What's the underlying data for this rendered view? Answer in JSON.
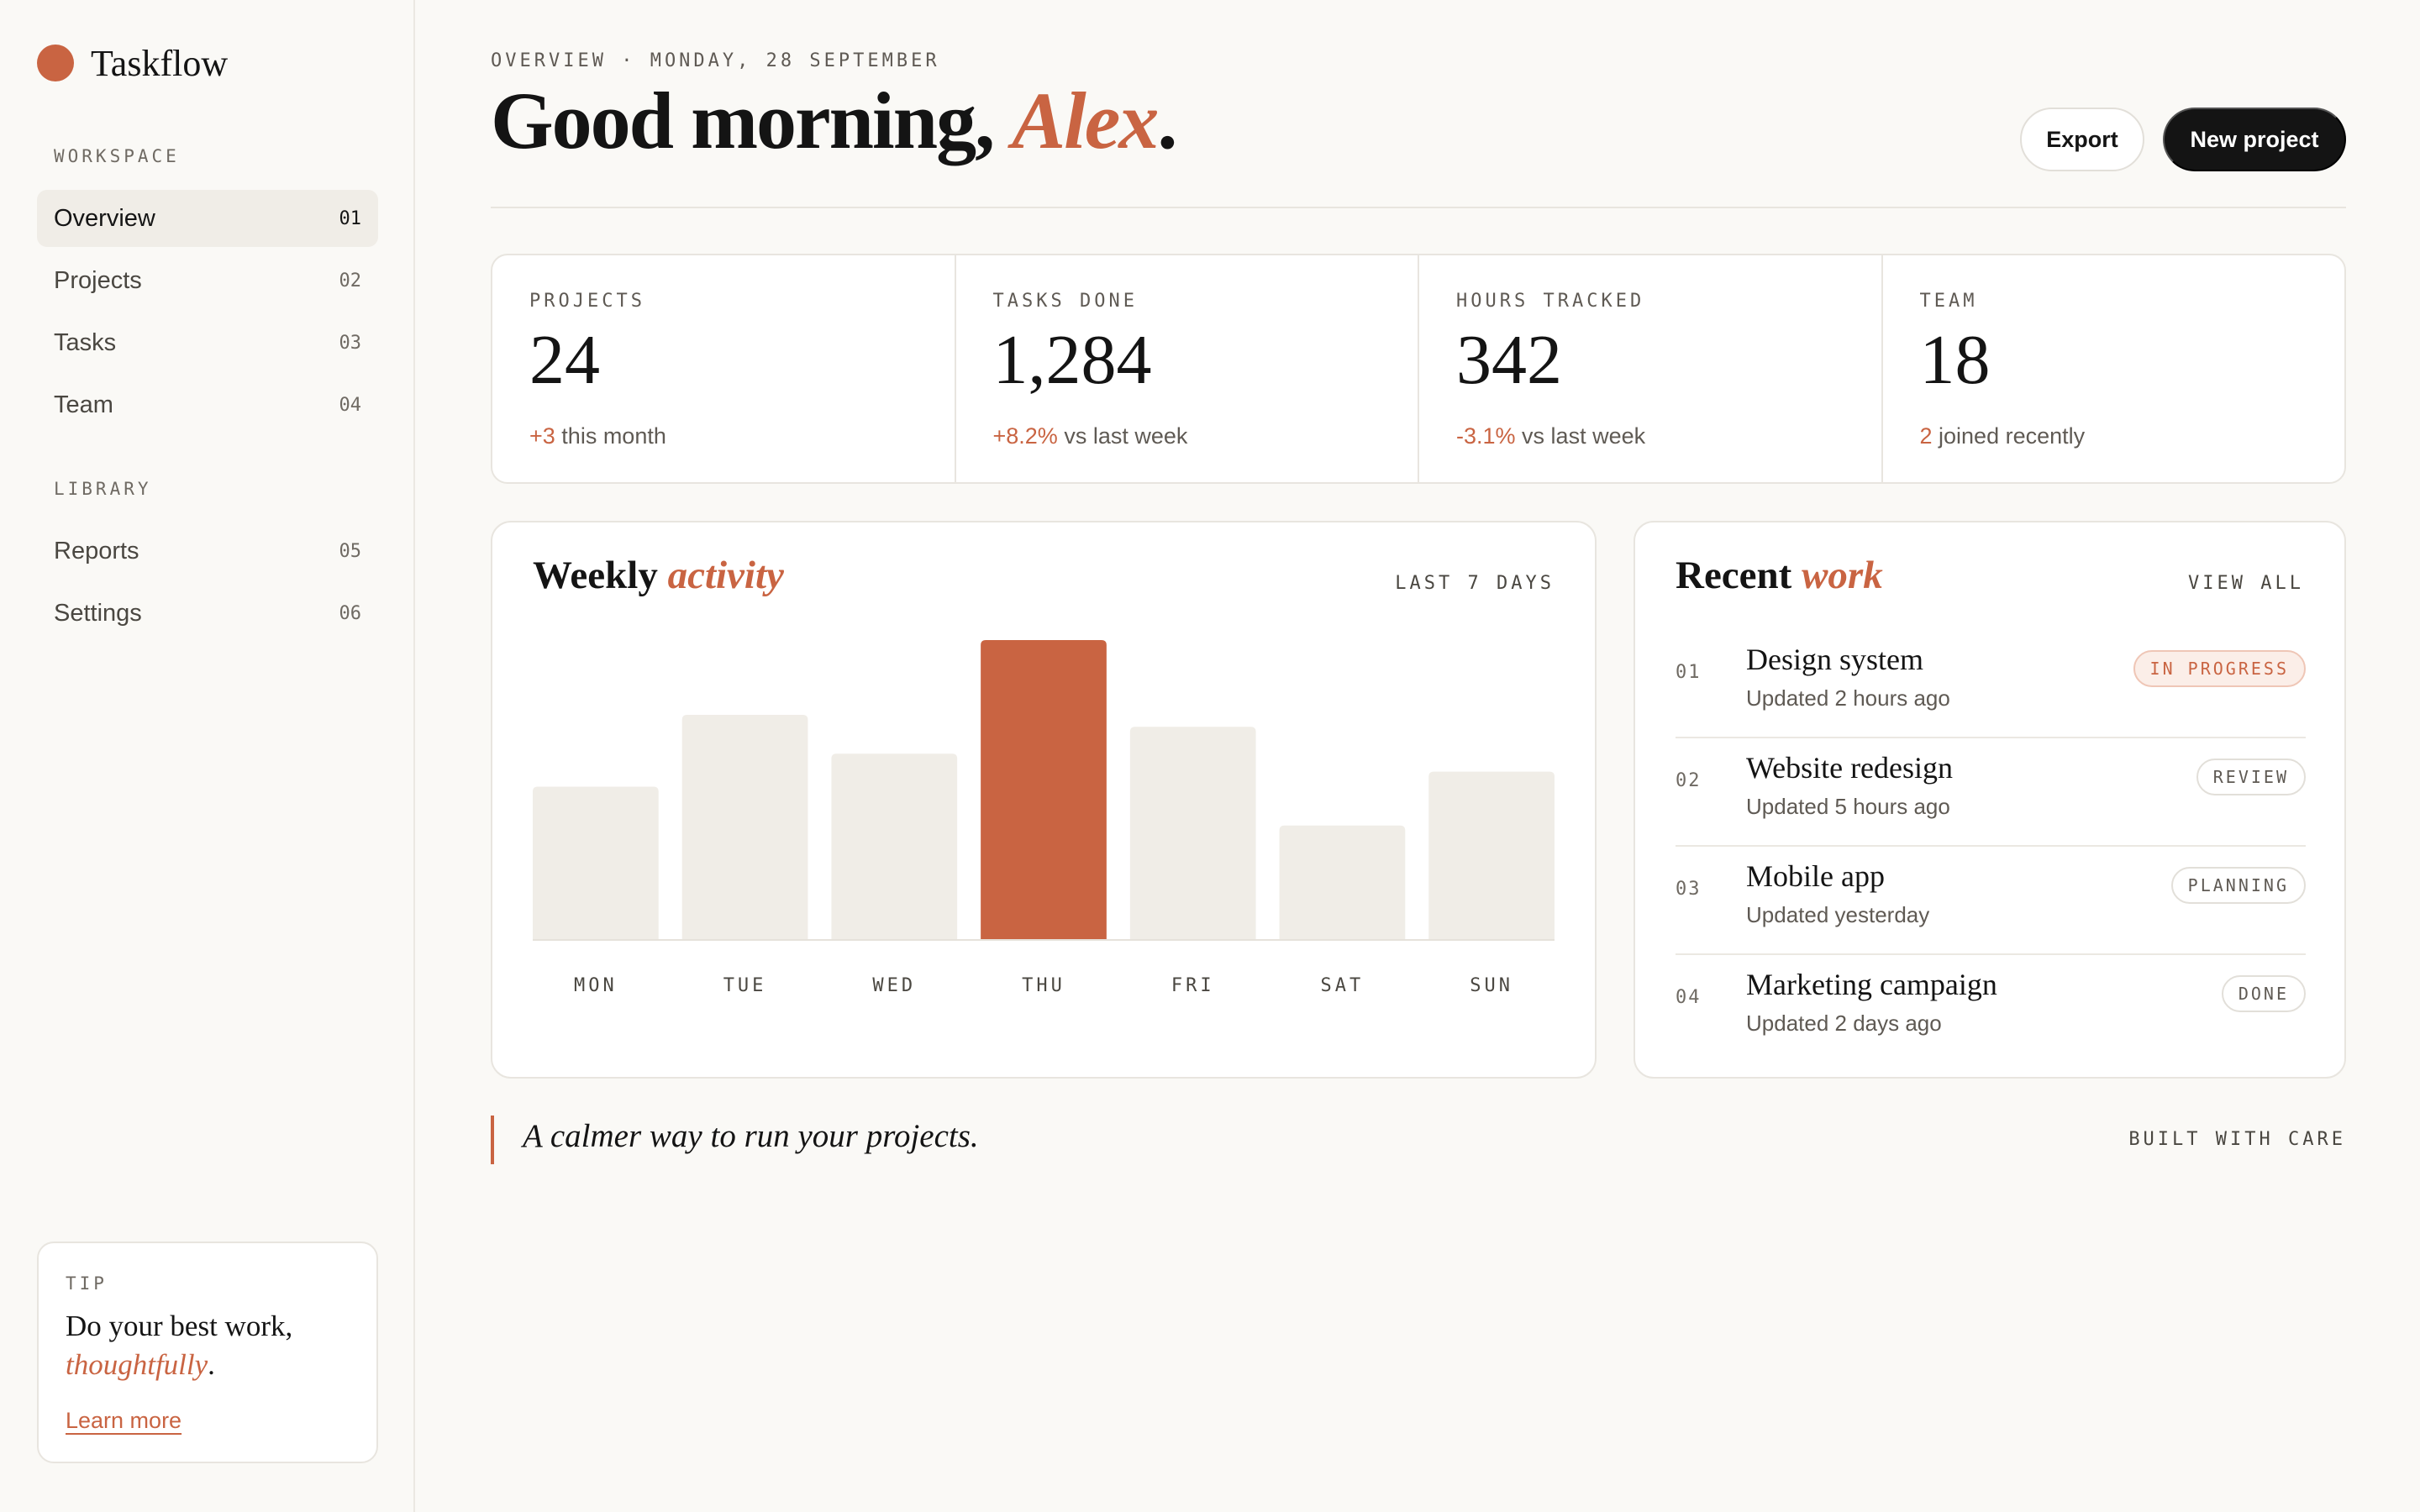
{
  "app": {
    "name": "Taskflow",
    "brand_color": "#c96442"
  },
  "sidebar": {
    "workspace_label": "WORKSPACE",
    "library_label": "LIBRARY",
    "workspace_items": [
      {
        "label": "Overview",
        "num": "01",
        "active": true
      },
      {
        "label": "Projects",
        "num": "02"
      },
      {
        "label": "Tasks",
        "num": "03"
      },
      {
        "label": "Team",
        "num": "04"
      }
    ],
    "library_items": [
      {
        "label": "Reports",
        "num": "05"
      },
      {
        "label": "Settings",
        "num": "06"
      }
    ],
    "tip": {
      "label": "TIP",
      "text_before": "Do your best work,",
      "text_accent": "thoughtfully",
      "text_after": ".",
      "link": "Learn more"
    }
  },
  "header": {
    "eyebrow": "OVERVIEW · MONDAY, 28 SEPTEMBER",
    "greeting": "Good morning, ",
    "name": "Alex",
    "punct": ".",
    "export_label": "Export",
    "new_project_label": "New project"
  },
  "stats": [
    {
      "label": "PROJECTS",
      "value": "24",
      "delta": "+3",
      "delta_text": " this month"
    },
    {
      "label": "TASKS DONE",
      "value": "1,284",
      "delta": "+8.2%",
      "delta_text": " vs last week"
    },
    {
      "label": "HOURS TRACKED",
      "value": "342",
      "delta": "-3.1%",
      "delta_text": " vs last week"
    },
    {
      "label": "TEAM",
      "value": "18",
      "delta": "2",
      "delta_text": " joined recently"
    }
  ],
  "activity": {
    "title": "Weekly ",
    "title_accent": "activity",
    "meta": "LAST 7 DAYS"
  },
  "chart_data": {
    "type": "bar",
    "categories": [
      "MON",
      "TUE",
      "WED",
      "THU",
      "FRI",
      "SAT",
      "SUN"
    ],
    "values": [
      51,
      75,
      62,
      100,
      71,
      38,
      56
    ],
    "highlight_index": 3,
    "ylim": [
      0,
      100
    ],
    "grid": false,
    "bar_color": "#f0ede7",
    "highlight_color": "#c96442"
  },
  "recent": {
    "title": "Recent ",
    "title_accent": "work",
    "view_all": "VIEW ALL",
    "items": [
      {
        "num": "01",
        "title": "Design system",
        "sub": "Updated 2 hours ago",
        "status": "IN PROGRESS",
        "status_kind": "progress"
      },
      {
        "num": "02",
        "title": "Website redesign",
        "sub": "Updated 5 hours ago",
        "status": "REVIEW",
        "status_kind": "neutral"
      },
      {
        "num": "03",
        "title": "Mobile app",
        "sub": "Updated yesterday",
        "status": "PLANNING",
        "status_kind": "neutral"
      },
      {
        "num": "04",
        "title": "Marketing campaign",
        "sub": "Updated 2 days ago",
        "status": "DONE",
        "status_kind": "neutral"
      }
    ]
  },
  "footer": {
    "quote": "A calmer way to run your projects.",
    "meta": "BUILT WITH CARE"
  }
}
